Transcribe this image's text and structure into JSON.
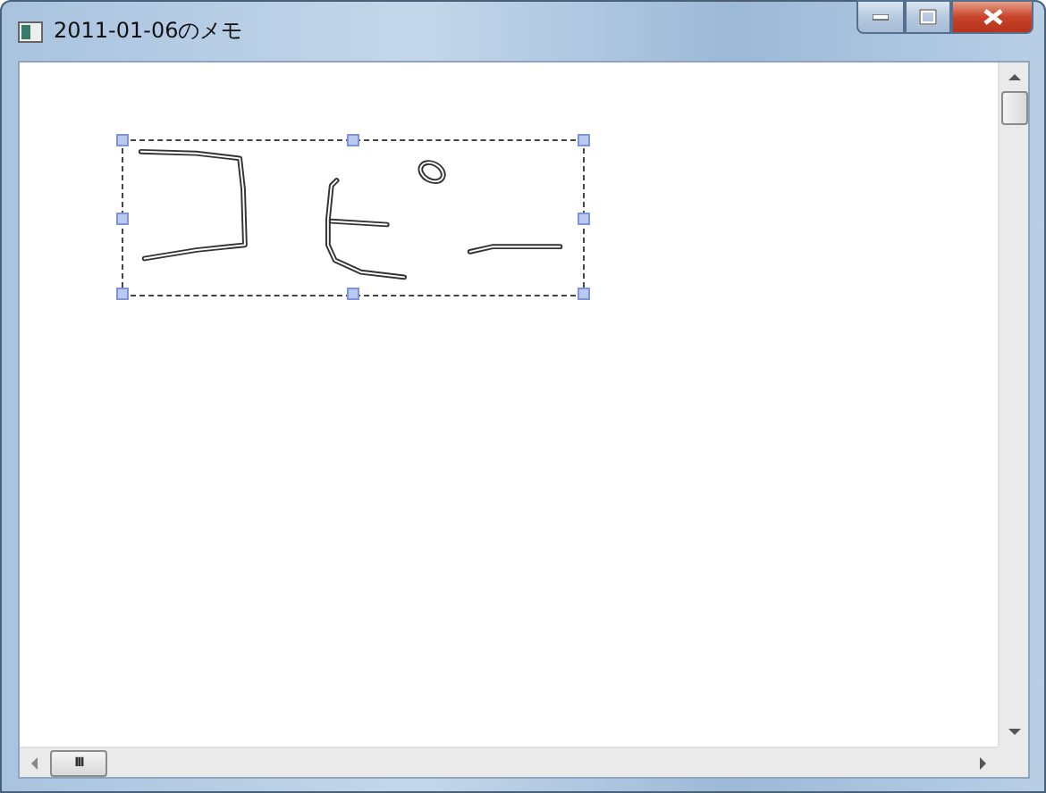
{
  "window": {
    "title": "2011-01-06のメモ"
  },
  "scrollbars": {
    "horizontal_grip": "III"
  }
}
